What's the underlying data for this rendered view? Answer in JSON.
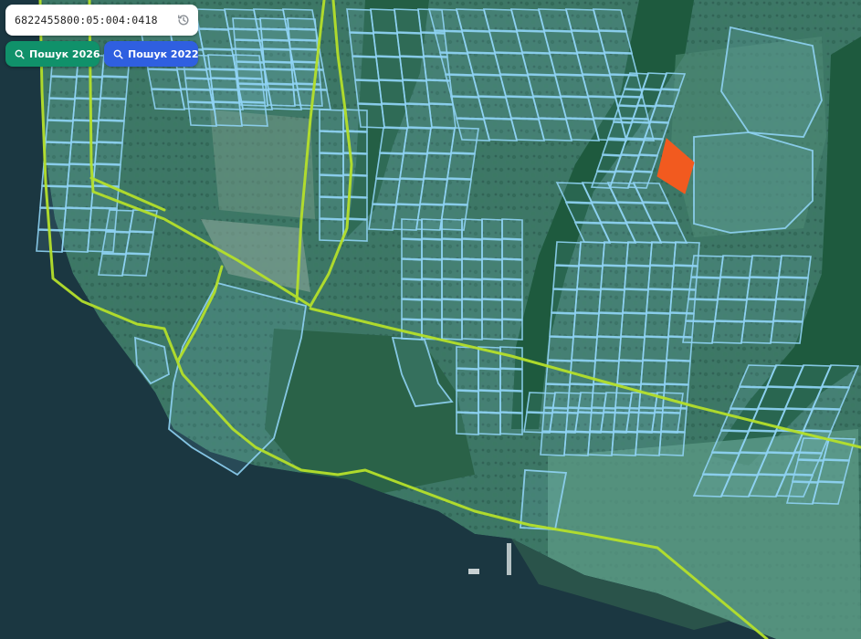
{
  "search": {
    "value": "6822455800:05:004:0418",
    "history_icon": "history-icon"
  },
  "buttons": {
    "search_2026": {
      "label": "Пошук 2026",
      "icon": "search-icon",
      "color": "#10916a"
    },
    "search_2022": {
      "label": "Пошук 2022",
      "icon": "search-icon",
      "color": "#2f5fe0"
    }
  },
  "map": {
    "parcel_outline_color": "#8fd3f4",
    "boundary_line_color": "#b5e02b",
    "selected_parcel_color": "#f25a1f",
    "water_color": "#1f3d48",
    "vegetation_color": "#2f6a58"
  }
}
